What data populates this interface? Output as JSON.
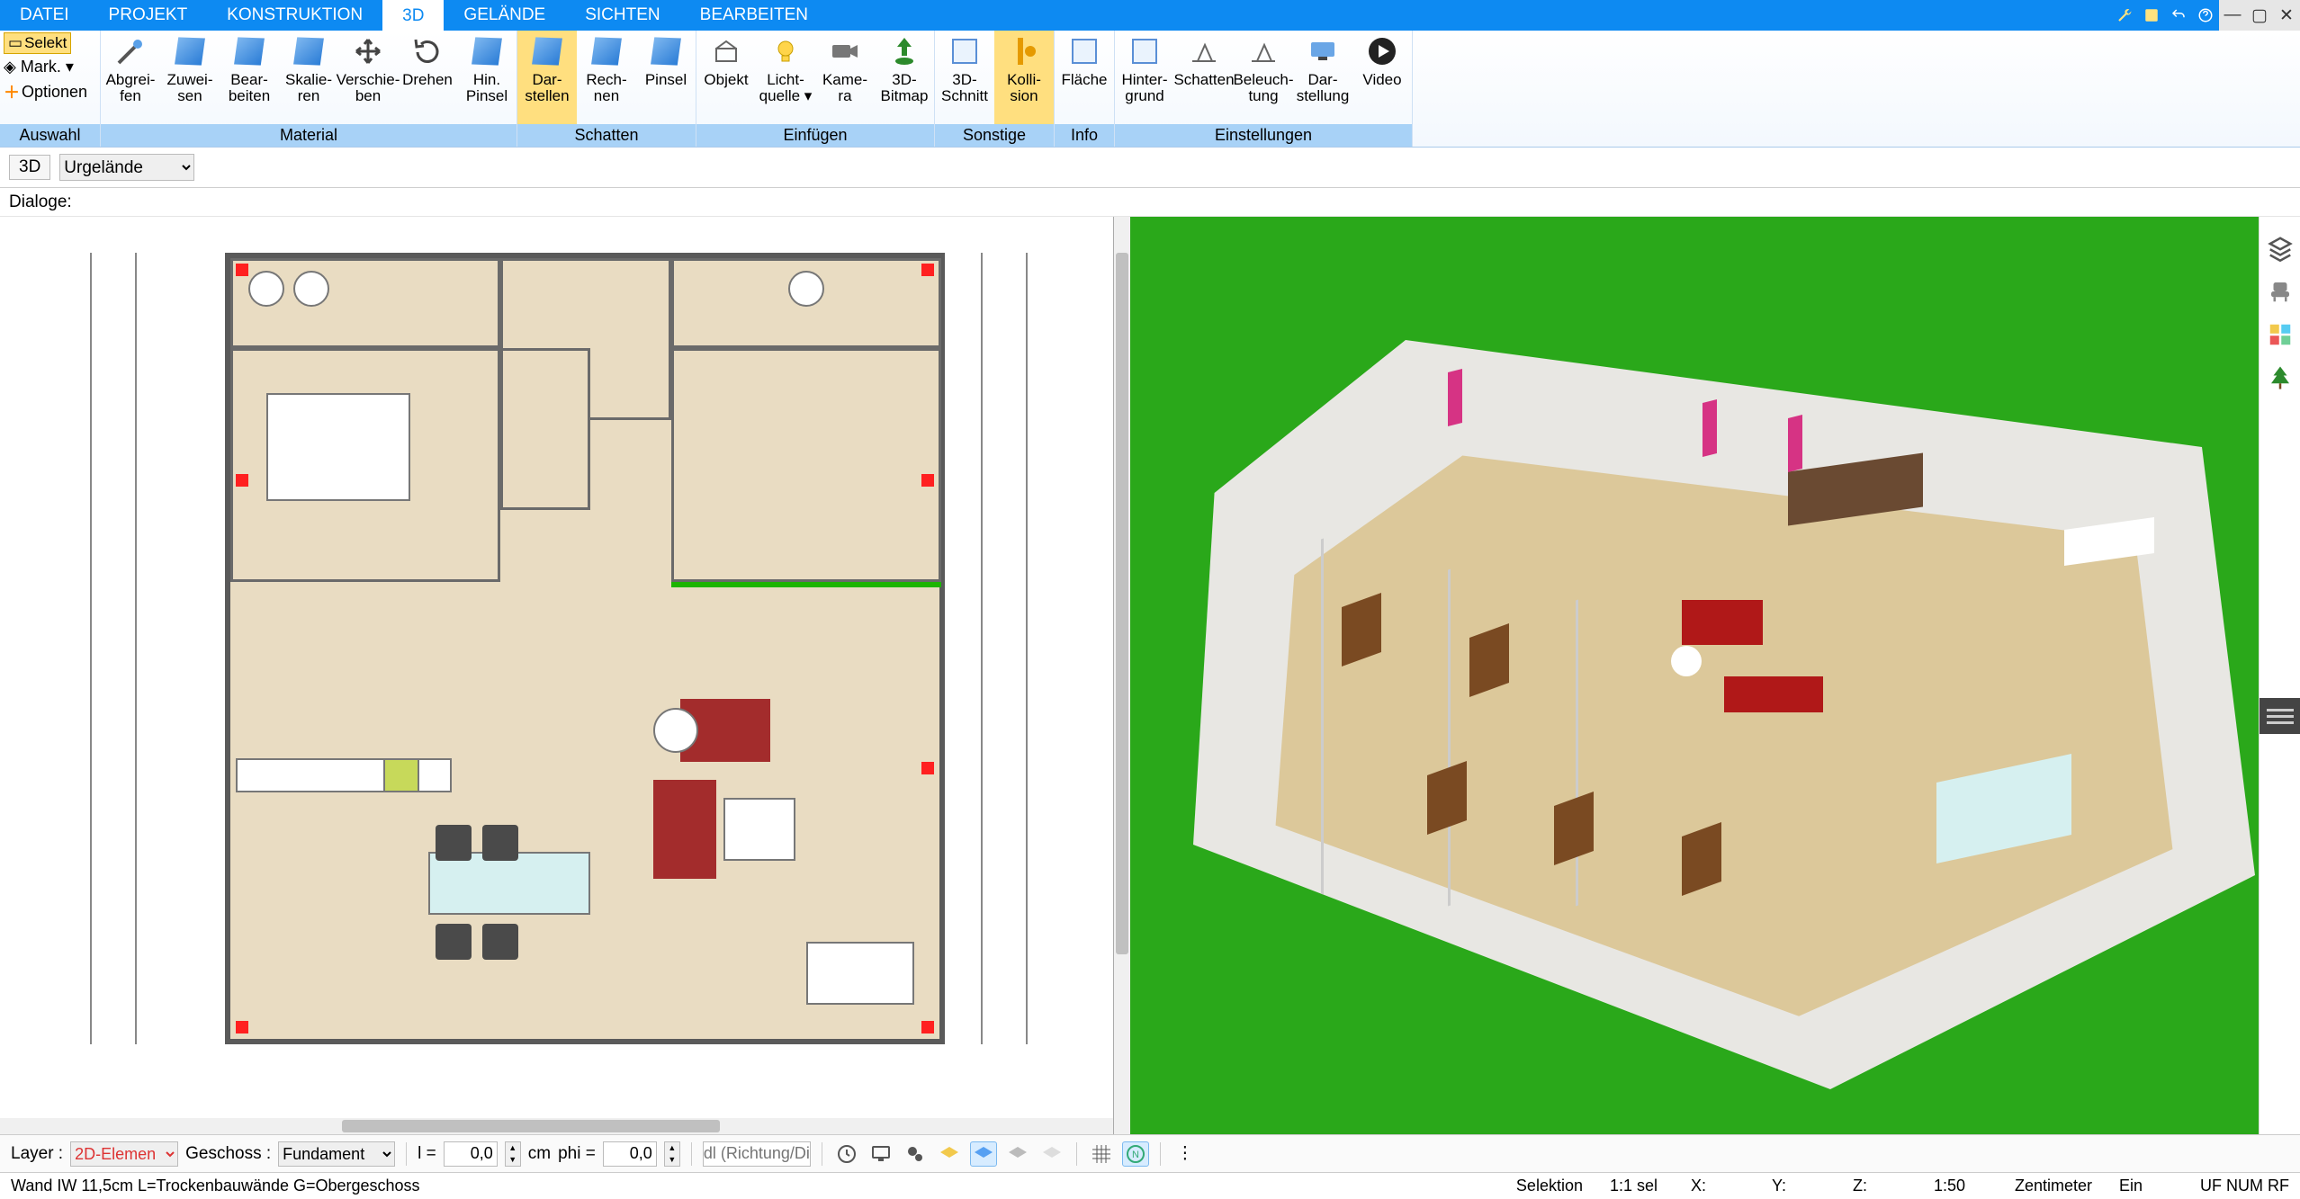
{
  "menu": {
    "tabs": [
      "DATEI",
      "PROJEKT",
      "KONSTRUKTION",
      "3D",
      "GELÄNDE",
      "SICHTEN",
      "BEARBEITEN"
    ],
    "active_index": 3
  },
  "leftcol": {
    "select": "Selekt",
    "mark": "Mark.",
    "options": "Optionen",
    "group": "Auswahl"
  },
  "ribbon_groups": [
    {
      "label": "Material",
      "buttons": [
        {
          "l": "Abgrei-\nfen"
        },
        {
          "l": "Zuwei-\nsen"
        },
        {
          "l": "Bear-\nbeiten"
        },
        {
          "l": "Skalie-\nren"
        },
        {
          "l": "Verschie-\nben"
        },
        {
          "l": "Drehen"
        },
        {
          "l": "Hin.\nPinsel"
        }
      ]
    },
    {
      "label": "Schatten",
      "highlight": true,
      "buttons": [
        {
          "l": "Dar-\nstellen",
          "active": true
        },
        {
          "l": "Rech-\nnen"
        },
        {
          "l": "Pinsel"
        }
      ]
    },
    {
      "label": "Einfügen",
      "buttons": [
        {
          "l": "Objekt"
        },
        {
          "l": "Licht-\nquelle ▾"
        },
        {
          "l": "Kame-\nra"
        },
        {
          "l": "3D-\nBitmap"
        }
      ]
    },
    {
      "label": "Sonstige",
      "buttons": [
        {
          "l": "3D-\nSchnitt"
        },
        {
          "l": "Kolli-\nsion",
          "active": true
        }
      ]
    },
    {
      "label": "Info",
      "buttons": [
        {
          "l": "Fläche"
        }
      ]
    },
    {
      "label": "Einstellungen",
      "buttons": [
        {
          "l": "Hinter-\ngrund"
        },
        {
          "l": "Schatten"
        },
        {
          "l": "Beleuch-\ntung"
        },
        {
          "l": "Dar-\nstellung"
        },
        {
          "l": "Video"
        }
      ]
    }
  ],
  "subbar": {
    "view_tag": "3D",
    "terrain": "Urgelände"
  },
  "dialogbar": {
    "label": "Dialoge:"
  },
  "bottombar": {
    "layer_label": "Layer :",
    "layer_value": "2D-Elemen",
    "floor_label": "Geschoss :",
    "floor_value": "Fundament",
    "l_eq": "l =",
    "l_val": "0,0",
    "unit": "cm",
    "phi_eq": "phi =",
    "phi_val": "0,0",
    "dir_placeholder": "dl (Richtung/Di"
  },
  "statusbar": {
    "hint": "Wand IW 11,5cm L=Trockenbauwände G=Obergeschoss",
    "selection": "Selektion",
    "ratio": "1:1 sel",
    "X": "X:",
    "Y": "Y:",
    "Z": "Z:",
    "scale": "1:50",
    "unit": "Zentimeter",
    "on": "Ein",
    "flags": "UF NUM RF"
  }
}
